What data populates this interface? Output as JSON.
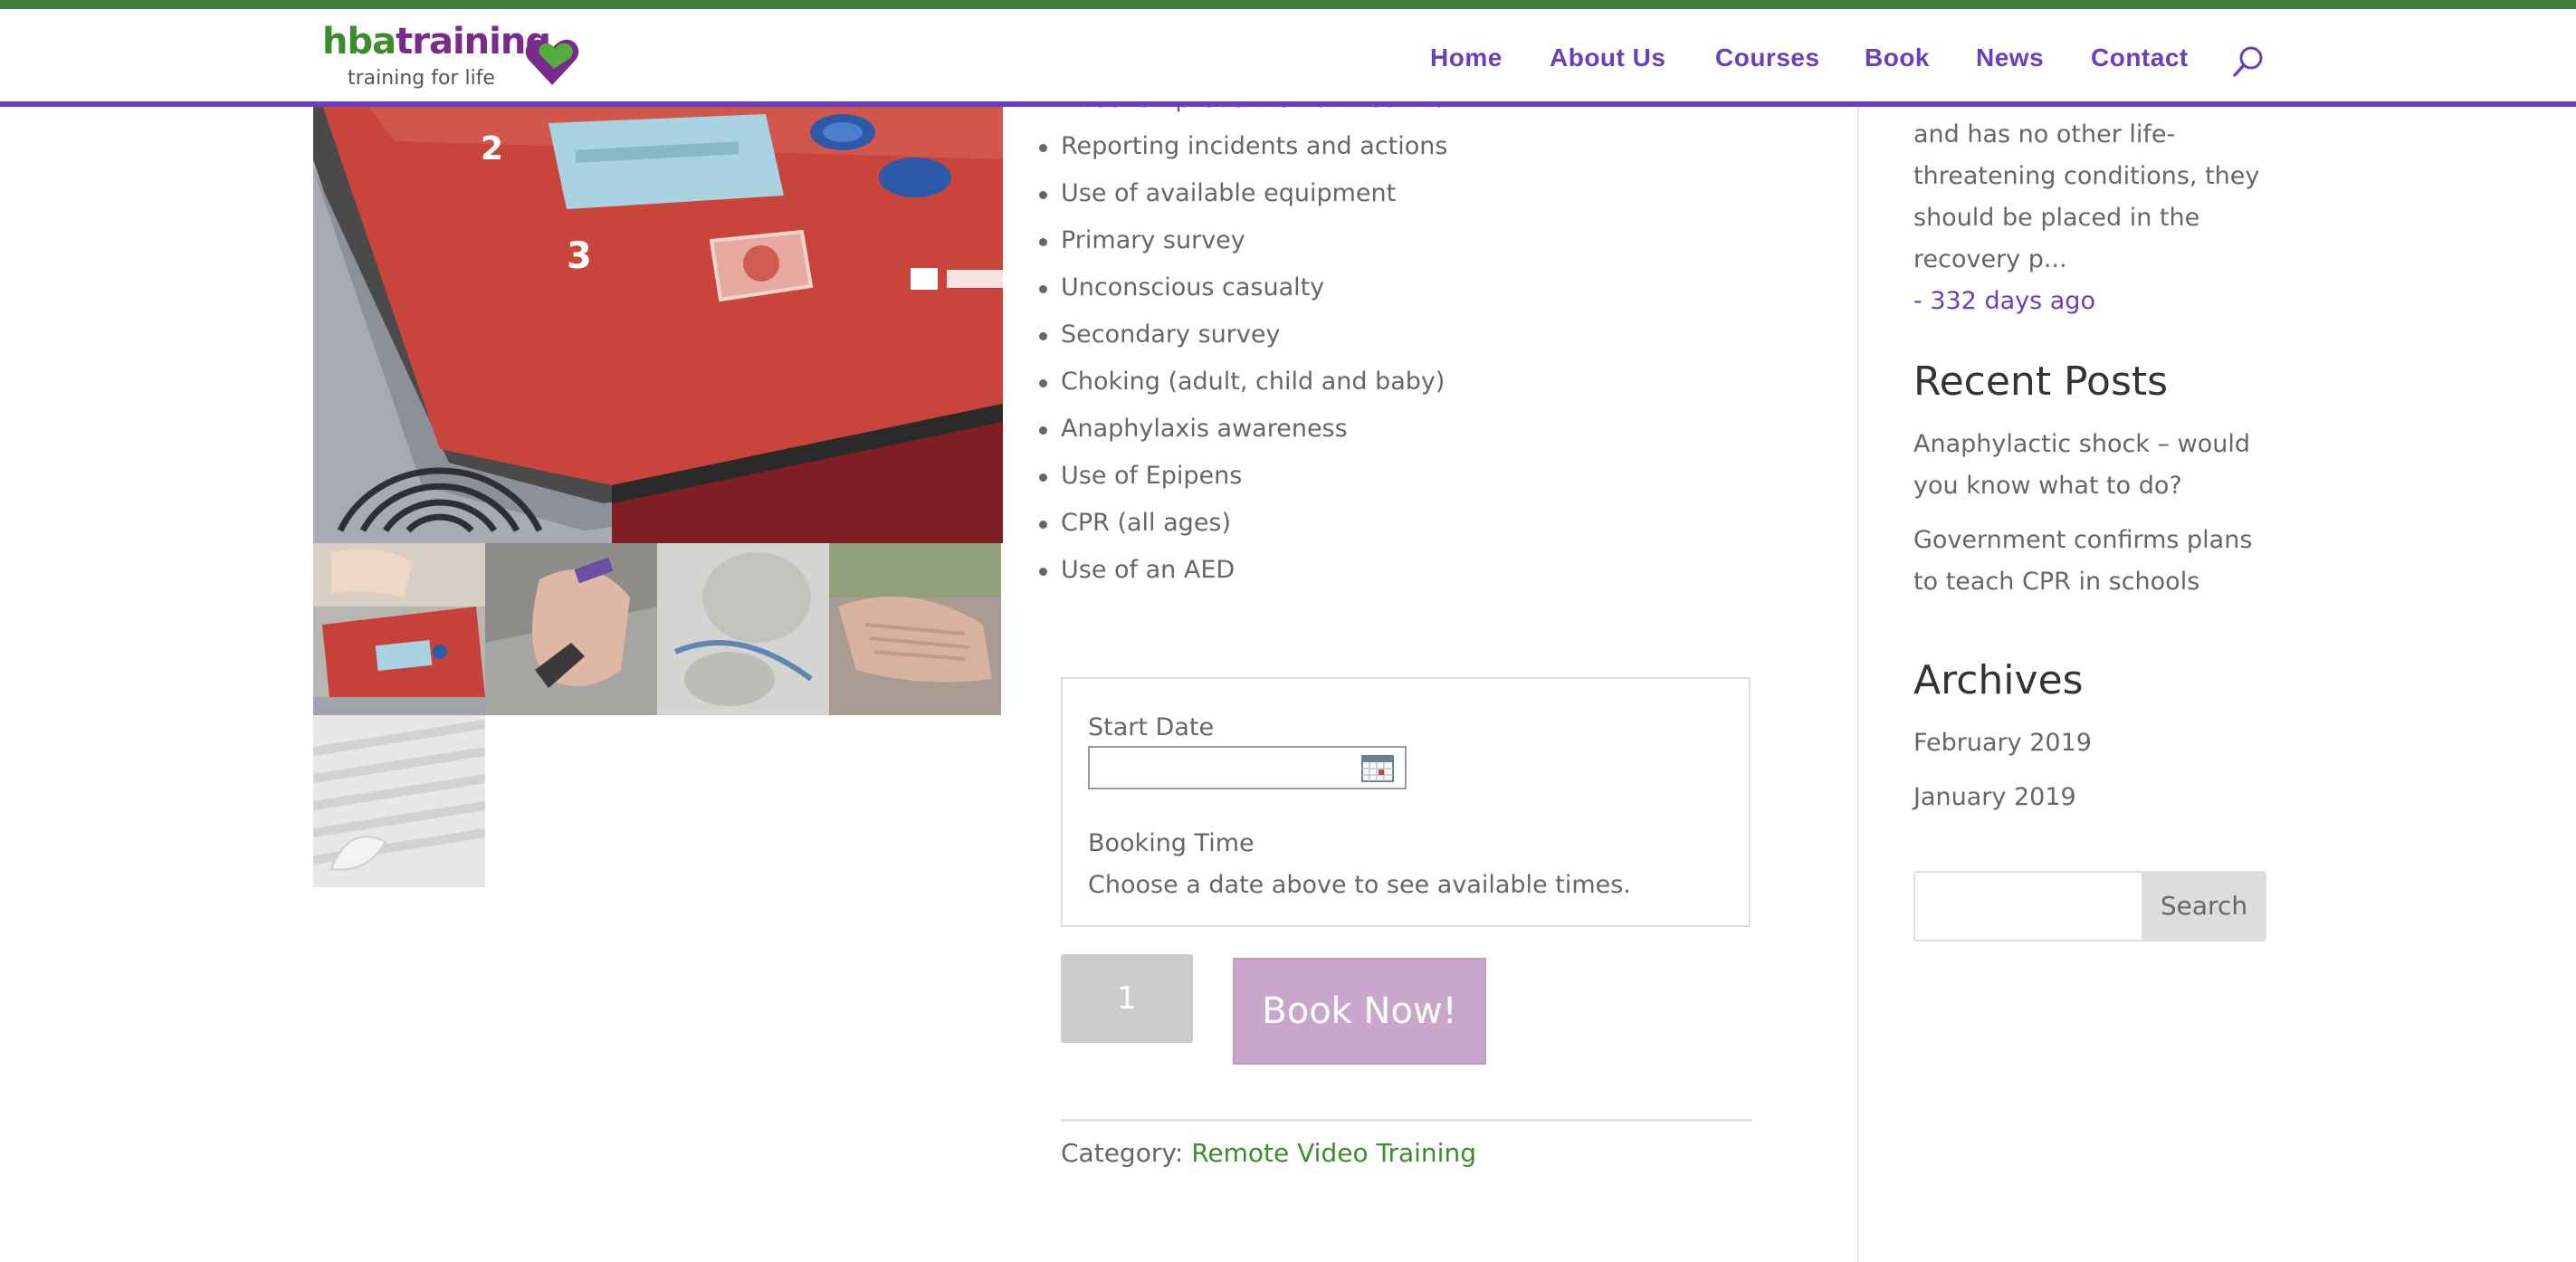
{
  "brand": {
    "name_part1": "hba",
    "name_part2": "training",
    "tagline": "training for life",
    "colors": {
      "green": "#3d8b2f",
      "purple": "#7a2a8a",
      "nav": "#6a3fbf"
    }
  },
  "nav": {
    "items": [
      "Home",
      "About Us",
      "Courses",
      "Book",
      "News",
      "Contact"
    ],
    "search_icon": "search-icon"
  },
  "gallery": {
    "main_image": "aed-training-device",
    "thumbnails": [
      "aed-device",
      "epipen-hand",
      "manikin-face",
      "cpr-hands",
      "bandage"
    ]
  },
  "course": {
    "topics": [
      "Infection prevention and control",
      "Reporting incidents and actions",
      "Use of available equipment",
      "Primary survey",
      "Unconscious casualty",
      "Secondary survey",
      "Choking (adult, child and baby)",
      "Anaphylaxis awareness",
      "Use of Epipens",
      "CPR (all ages)",
      "Use of an AED"
    ]
  },
  "booking": {
    "start_date_label": "Start Date",
    "start_date_value": "",
    "calendar_icon": "calendar-icon",
    "booking_time_label": "Booking Time",
    "booking_time_hint": "Choose a date above to see available times.",
    "quantity": "1",
    "book_button": "Book Now!"
  },
  "category": {
    "label": "Category:",
    "value": "Remote Video Training"
  },
  "sidebar": {
    "excerpt_lines": [
      "and has no other life-",
      "threatening conditions, they",
      "should be placed in the",
      "recovery p..."
    ],
    "excerpt_age": "- 332 days ago",
    "recent_posts_heading": "Recent Posts",
    "recent_posts": [
      {
        "line1": "Anaphylactic shock – would",
        "line2": "you know what to do?"
      },
      {
        "line1": "Government confirms plans",
        "line2": "to teach CPR in schools"
      }
    ],
    "archives_heading": "Archives",
    "archives": [
      "February 2019",
      "January 2019"
    ],
    "search_button": "Search",
    "search_value": ""
  }
}
